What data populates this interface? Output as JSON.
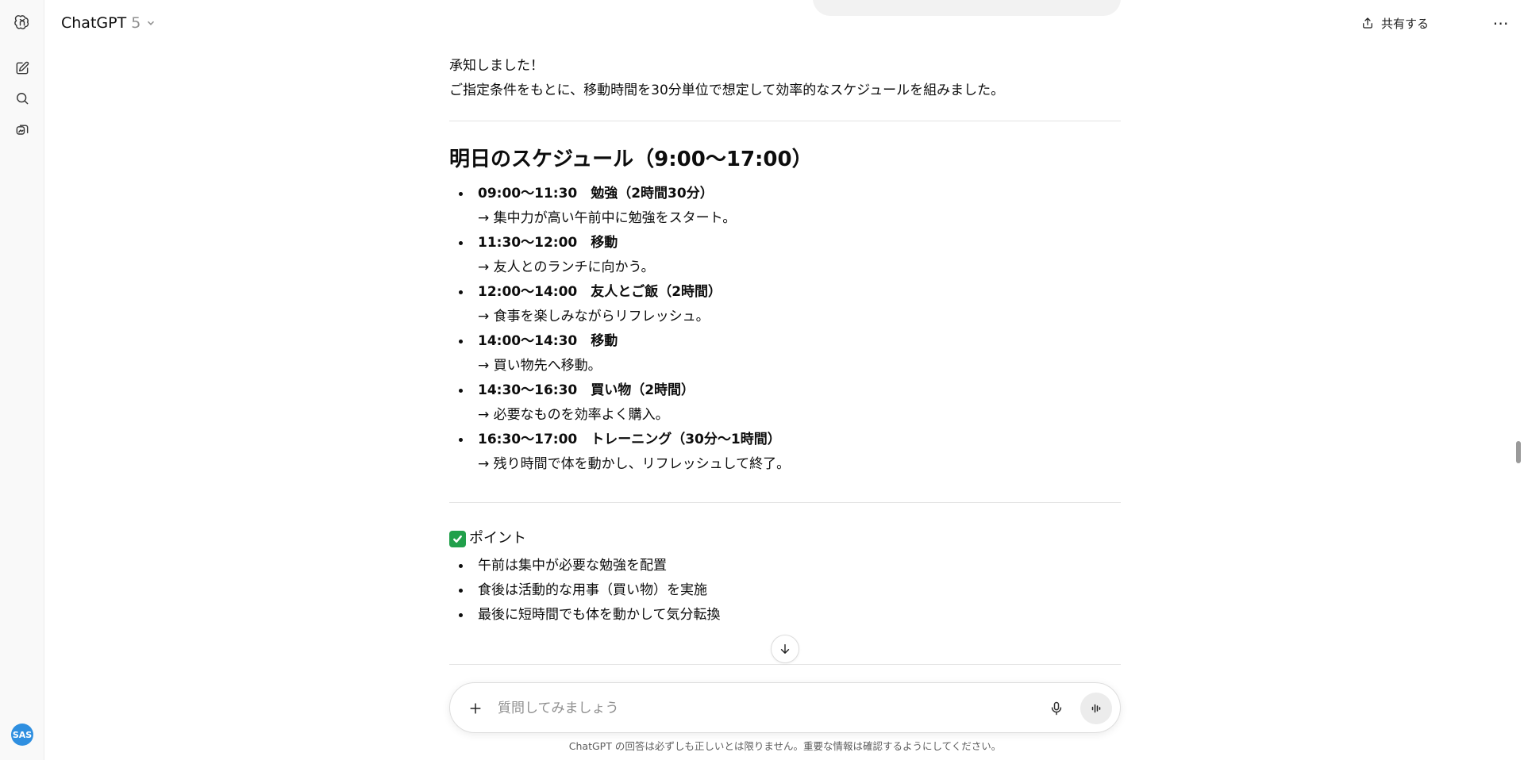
{
  "header": {
    "model_name": "ChatGPT",
    "model_version": "5",
    "share_label": "共有する",
    "more_label": "⋯"
  },
  "sidebar": {
    "avatar_initials": "SAS",
    "icons": [
      "openai-logo-icon",
      "new-chat-icon",
      "search-icon",
      "library-icon"
    ]
  },
  "chat": {
    "intro_lines": [
      "承知しました！",
      "ご指定条件をもとに、移動時間を30分単位で想定して効率的なスケジュールを組みました。"
    ],
    "schedule_heading": "明日のスケジュール（9:00〜17:00）",
    "schedule": [
      {
        "title": "09:00〜11:30　勉強（2時間30分）",
        "note": "→ 集中力が高い午前中に勉強をスタート。"
      },
      {
        "title": "11:30〜12:00　移動",
        "note": "→ 友人とのランチに向かう。"
      },
      {
        "title": "12:00〜14:00　友人とご飯（2時間）",
        "note": "→ 食事を楽しみながらリフレッシュ。"
      },
      {
        "title": "14:00〜14:30　移動",
        "note": "→ 買い物先へ移動。"
      },
      {
        "title": "14:30〜16:30　買い物（2時間）",
        "note": "→ 必要なものを効率よく購入。"
      },
      {
        "title": "16:30〜17:00　トレーニング（30分〜1時間）",
        "note": "→ 残り時間で体を動かし、リフレッシュして終了。"
      }
    ],
    "points_heading": "ポイント",
    "points": [
      "午前は集中が必要な勉強を配置",
      "食後は活動的な用事（買い物）を実施",
      "最後に短時間でも体を動かして気分転換"
    ]
  },
  "composer": {
    "placeholder": "質問してみましょう",
    "value": ""
  },
  "disclaimer": "ChatGPT の回答は必ずしも正しいとは限りません。重要な情報は確認するようにしてください。",
  "colors": {
    "accent_check": "#21a04b",
    "avatar_bg": "#2f8fe0"
  }
}
